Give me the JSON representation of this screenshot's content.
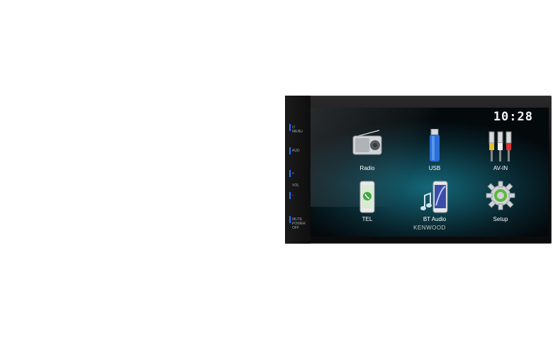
{
  "clock": "10:28",
  "brand": "KENWOOD",
  "side_keys": {
    "menu": "MENU",
    "aud": "AUD",
    "vol_plus": "+",
    "vol": "VOL",
    "vol_minus": "−",
    "mute": "MUTE",
    "power_off": "POWER OFF"
  },
  "apps": [
    {
      "label": "Radio",
      "icon": "radio-icon"
    },
    {
      "label": "USB",
      "icon": "usb-drive-icon"
    },
    {
      "label": "AV-IN",
      "icon": "rca-connectors-icon"
    },
    {
      "label": "TEL",
      "icon": "phone-icon"
    },
    {
      "label": "BT Audio",
      "icon": "bluetooth-audio-icon"
    },
    {
      "label": "Setup",
      "icon": "gear-icon"
    }
  ]
}
